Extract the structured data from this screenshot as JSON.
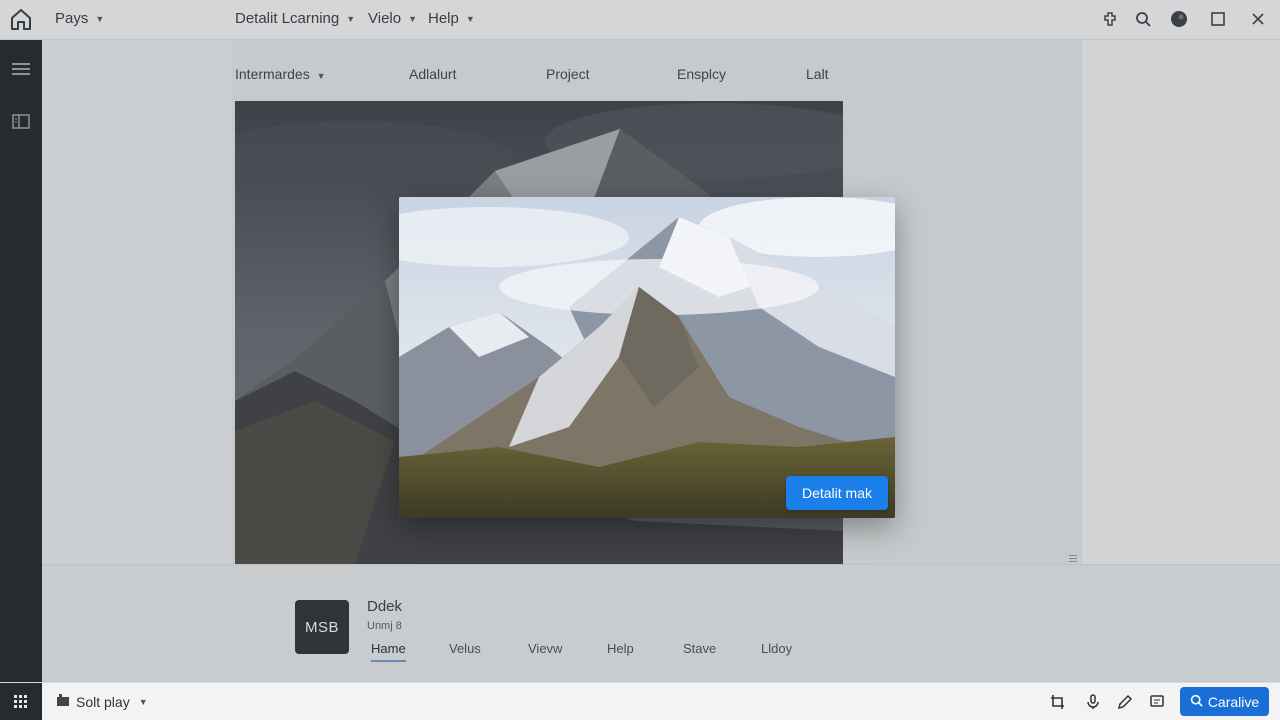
{
  "topbar": {
    "pays_label": "Pays",
    "menus": [
      {
        "label": "Detalit Lcarning"
      },
      {
        "label": "Vielo"
      },
      {
        "label": "Help"
      }
    ]
  },
  "tabs": [
    {
      "label": "Intermardes"
    },
    {
      "label": "Adlalurt"
    },
    {
      "label": "Project"
    },
    {
      "label": "Ensplcy"
    },
    {
      "label": "Lalt"
    }
  ],
  "modal": {
    "button_label": "Detalit mak"
  },
  "lower": {
    "thumb_text": "MSB",
    "title": "Ddek",
    "subtitle": "Unmj 8",
    "tabs": [
      {
        "label": "Hame"
      },
      {
        "label": "Velus"
      },
      {
        "label": "Vievw"
      },
      {
        "label": "Help"
      },
      {
        "label": "Stave"
      },
      {
        "label": "Lldoy"
      }
    ]
  },
  "bottombar": {
    "split_label": "Solt play",
    "action_label": "Caralive"
  },
  "colors": {
    "accent": "#1a7fe8",
    "rail": "#262b30"
  }
}
